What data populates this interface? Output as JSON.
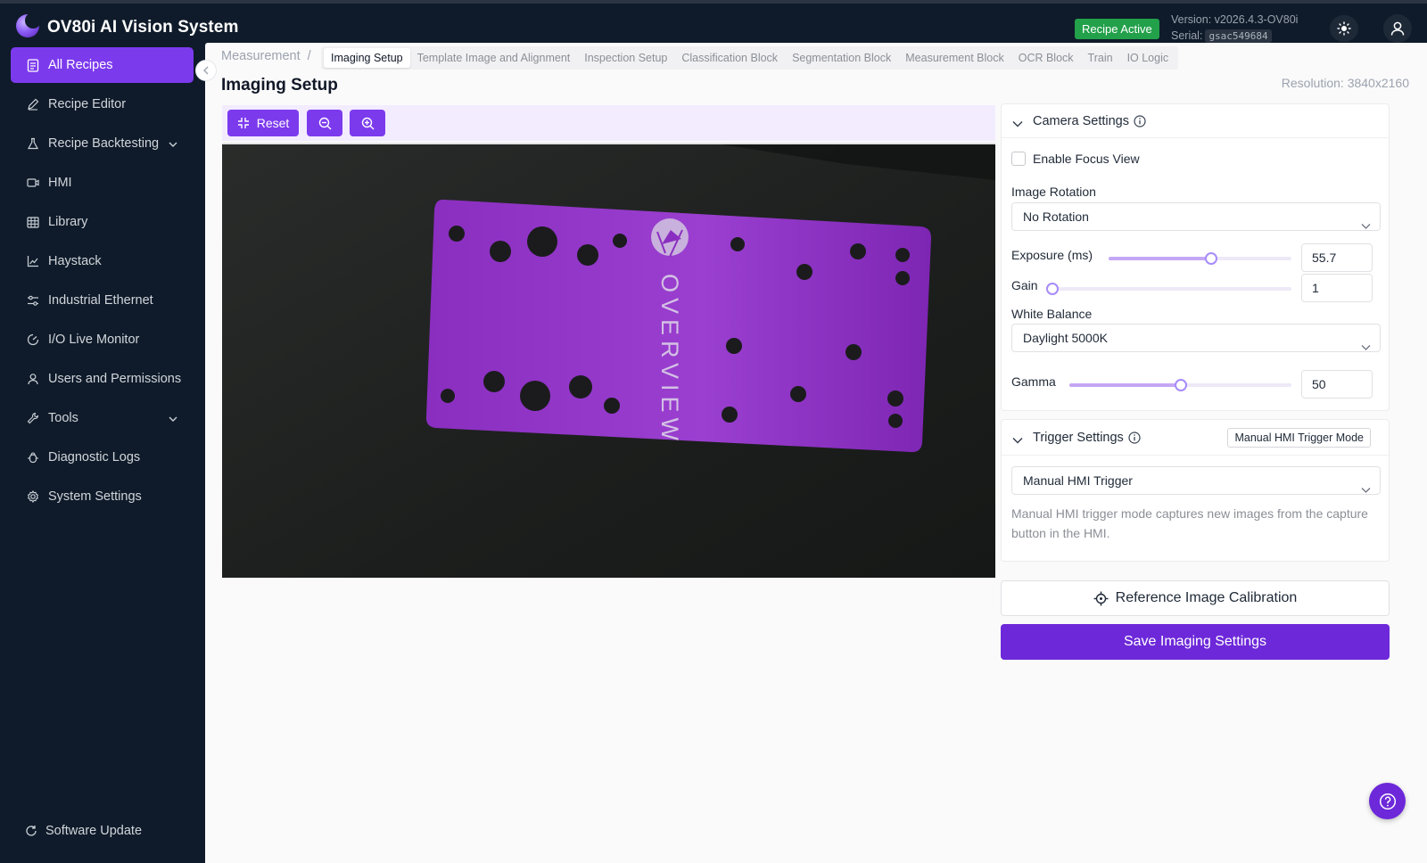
{
  "app": {
    "title": "OV80i AI Vision System"
  },
  "header": {
    "recipe_status": "Recipe Active",
    "version": "Version: v2026.4.3-OV80i",
    "serial_label": "Serial:",
    "serial_code": "gsac549684",
    "icons": {
      "theme": "sun-icon",
      "user": "user-icon"
    }
  },
  "sidebar": {
    "items": [
      {
        "label": "All Recipes",
        "icon": "recipes-icon",
        "active": true
      },
      {
        "label": "Recipe Editor",
        "icon": "pencil-icon"
      },
      {
        "label": "Recipe Backtesting",
        "icon": "flask-icon",
        "expandable": true
      },
      {
        "label": "HMI",
        "icon": "camera-icon"
      },
      {
        "label": "Library",
        "icon": "table-icon"
      },
      {
        "label": "Haystack",
        "icon": "chart-icon"
      },
      {
        "label": "Industrial Ethernet",
        "icon": "sliders-icon"
      },
      {
        "label": "I/O Live Monitor",
        "icon": "gauge-icon"
      },
      {
        "label": "Users and Permissions",
        "icon": "user-icon"
      },
      {
        "label": "Tools",
        "icon": "wrench-icon",
        "expandable": true
      },
      {
        "label": "Diagnostic Logs",
        "icon": "bug-icon"
      },
      {
        "label": "System Settings",
        "icon": "gear-icon"
      }
    ],
    "footer": "Software Update"
  },
  "breadcrumb": {
    "root": "Measurement",
    "sep": "/"
  },
  "tabs": [
    {
      "label": "Imaging Setup",
      "active": true
    },
    {
      "label": "Template Image and Alignment"
    },
    {
      "label": "Inspection Setup"
    },
    {
      "label": "Classification Block"
    },
    {
      "label": "Segmentation Block"
    },
    {
      "label": "Measurement Block"
    },
    {
      "label": "OCR Block"
    },
    {
      "label": "Train"
    },
    {
      "label": "IO Logic"
    }
  ],
  "page": {
    "title": "Imaging Setup",
    "resolution": "Resolution: 3840x2160"
  },
  "viewer": {
    "reset_label": "Reset",
    "image_text": "OVERVIEW",
    "colors": {
      "plate": "#8e2fc2",
      "background": "#1f2120"
    }
  },
  "camera": {
    "title": "Camera Settings",
    "focus_view_label": "Enable Focus View",
    "focus_view_checked": false,
    "rotation_label": "Image Rotation",
    "rotation_value": "No Rotation",
    "exposure_label": "Exposure (ms)",
    "exposure_value": "55.7",
    "exposure_level": 0.56,
    "gain_label": "Gain",
    "gain_value": "1",
    "gain_level": 0.0,
    "wb_label": "White Balance",
    "wb_value": "Daylight 5000K",
    "gamma_label": "Gamma",
    "gamma_value": "50",
    "gamma_level": 0.5
  },
  "trigger": {
    "title": "Trigger Settings",
    "mode_badge": "Manual HMI Trigger Mode",
    "select_value": "Manual HMI Trigger",
    "hint": "Manual HMI trigger mode captures new images from the capture button in the HMI."
  },
  "actions": {
    "reference_label": "Reference Image Calibration",
    "save_label": "Save Imaging Settings"
  },
  "colors": {
    "accent": "#7c3aed",
    "sidebar": "#0f1b2a",
    "active_badge": "#22a04a"
  }
}
